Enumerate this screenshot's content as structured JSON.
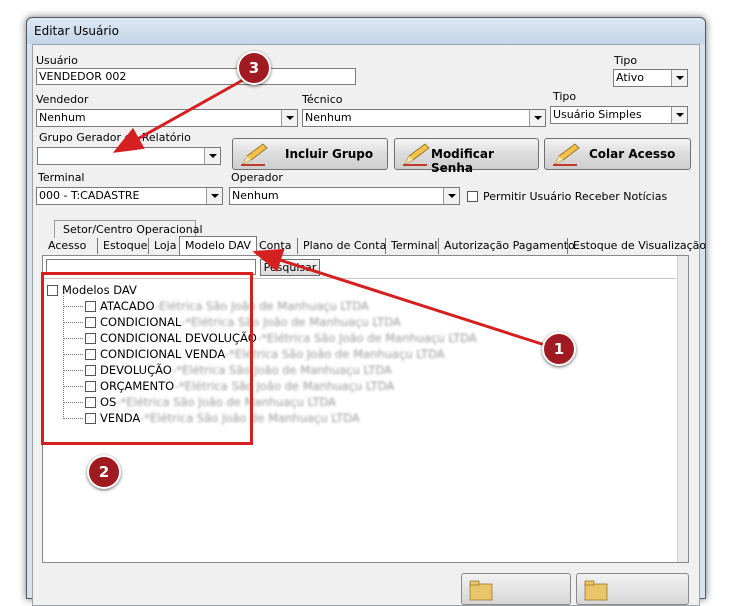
{
  "window": {
    "title": "Editar Usuário"
  },
  "form": {
    "usuario_label": "Usuário",
    "usuario_value": "VENDEDOR 002",
    "tipo1_label": "Tipo",
    "tipo1_value": "Ativo",
    "vendedor_label": "Vendedor",
    "vendedor_value": "Nenhum",
    "tecnico_label": "Técnico",
    "tecnico_value": "Nenhum",
    "tipo2_label": "Tipo",
    "tipo2_value": "Usuário Simples",
    "grupo_label": "Grupo Gerador de Relatório",
    "grupo_value": "",
    "terminal_label": "Terminal",
    "terminal_value": "000 - T:CADASTRE",
    "operador_label": "Operador",
    "operador_value": "Nenhum",
    "noticias_label": "Permitir Usuário Receber Notícias"
  },
  "buttons": {
    "incluir_grupo": "Incluir Grupo",
    "modificar_senha": "Modificar Senha",
    "colar_acesso": "Colar Acesso",
    "pesquisar": "Pesquisar"
  },
  "tabs_row1": [
    "Setor/Centro Operacional"
  ],
  "tabs_row2": [
    "Acesso",
    "Estoque",
    "Loja",
    "Modelo DAV",
    "Conta",
    "Plano de Conta",
    "Terminal",
    "Autorização Pagamento",
    "Estoque de Visualização"
  ],
  "active_tab": "Modelo DAV",
  "tree": {
    "root": "Modelos DAV",
    "items": [
      {
        "name": "ATACADO",
        "suffix": "-Elétrica São João de Manhuaçu LTDA"
      },
      {
        "name": "CONDICIONAL",
        "suffix": "-*Elétrica São João de Manhuaçu LTDA"
      },
      {
        "name": "CONDICIONAL DEVOLUÇÃO",
        "suffix": "-*Elétrica São João de Manhuaçu LTDA"
      },
      {
        "name": "CONDICIONAL VENDA",
        "suffix": "-*Elétrica São João de Manhuaçu LTDA"
      },
      {
        "name": "DEVOLUÇÃO",
        "suffix": "-*Elétrica São João de Manhuaçu LTDA"
      },
      {
        "name": "ORÇAMENTO",
        "suffix": "-*Elétrica São João de Manhuaçu LTDA"
      },
      {
        "name": "OS",
        "suffix": "-*Elétrica São João de Manhuaçu LTDA"
      },
      {
        "name": "VENDA",
        "suffix": "-*Elétrica São João de Manhuaçu LTDA"
      }
    ]
  },
  "annotations": {
    "marker1": "1",
    "marker2": "2",
    "marker3": "3"
  },
  "colors": {
    "marker": "#a01a22",
    "highlight_box": "#d42020",
    "arrow": "#d42020"
  }
}
